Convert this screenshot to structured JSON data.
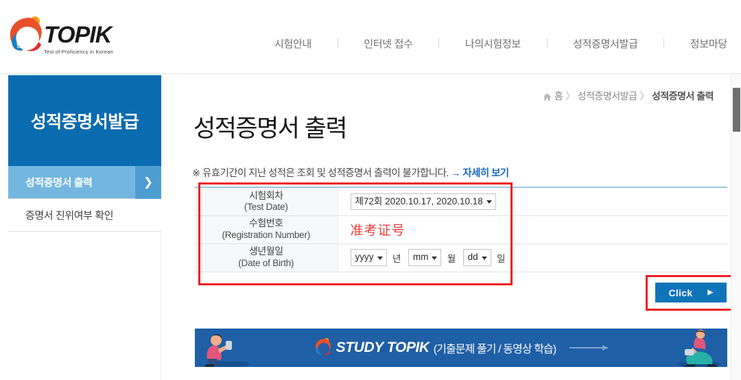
{
  "site": {
    "logo_text": "TOPIK",
    "logo_tagline": "Test of Proficiency in Korean"
  },
  "nav": {
    "items": [
      {
        "label": "시험안내"
      },
      {
        "label": "인터넷 접수"
      },
      {
        "label": "나의시험정보"
      },
      {
        "label": "성적증명서발급"
      },
      {
        "label": "정보마당"
      }
    ]
  },
  "sidebar": {
    "title": "성적증명서발급",
    "items": [
      {
        "label": "성적증명서 출력",
        "active": true
      },
      {
        "label": "증명서 진위여부 확인",
        "active": false
      }
    ],
    "arrow_glyph": "❯"
  },
  "breadcrumb": {
    "home_icon": "home-icon",
    "home": "홈",
    "sep": "〉",
    "section": "성적증명서발급",
    "current": "성적증명서 출력"
  },
  "main": {
    "page_title": "성적증명서 출력",
    "notice_text": "※ 유효기간이 지난 성적은 조회 및 성적증명서 출력이 불가합니다.",
    "notice_link": "→ 자세히 보기"
  },
  "form": {
    "rows": [
      {
        "label_ko": "시험회차",
        "label_en": "(Test Date)",
        "select_value": "제72회 2020.10.17, 2020.10.18"
      },
      {
        "label_ko": "수험번호",
        "label_en": "(Registration Number)",
        "input_value": "准考证号"
      },
      {
        "label_ko": "생년월일",
        "label_en": "(Date of Birth)",
        "year_value": "yyyy",
        "year_unit": "년",
        "month_value": "mm",
        "month_unit": "월",
        "day_value": "dd",
        "day_unit": "일"
      }
    ],
    "submit_label": "Click",
    "submit_arrow": "▶"
  },
  "banner": {
    "title": "STUDY TOPIK",
    "subtitle": "(기출문제 풀기 / 동영상 학습)"
  },
  "colors": {
    "brand_blue": "#0a6cb0",
    "sidebar_active": "#73b7e0",
    "link_blue": "#1566c0",
    "annotation_red": "#ee1c23",
    "regnum_red": "#ef3b3b",
    "banner_blue": "#1f5fa6"
  }
}
